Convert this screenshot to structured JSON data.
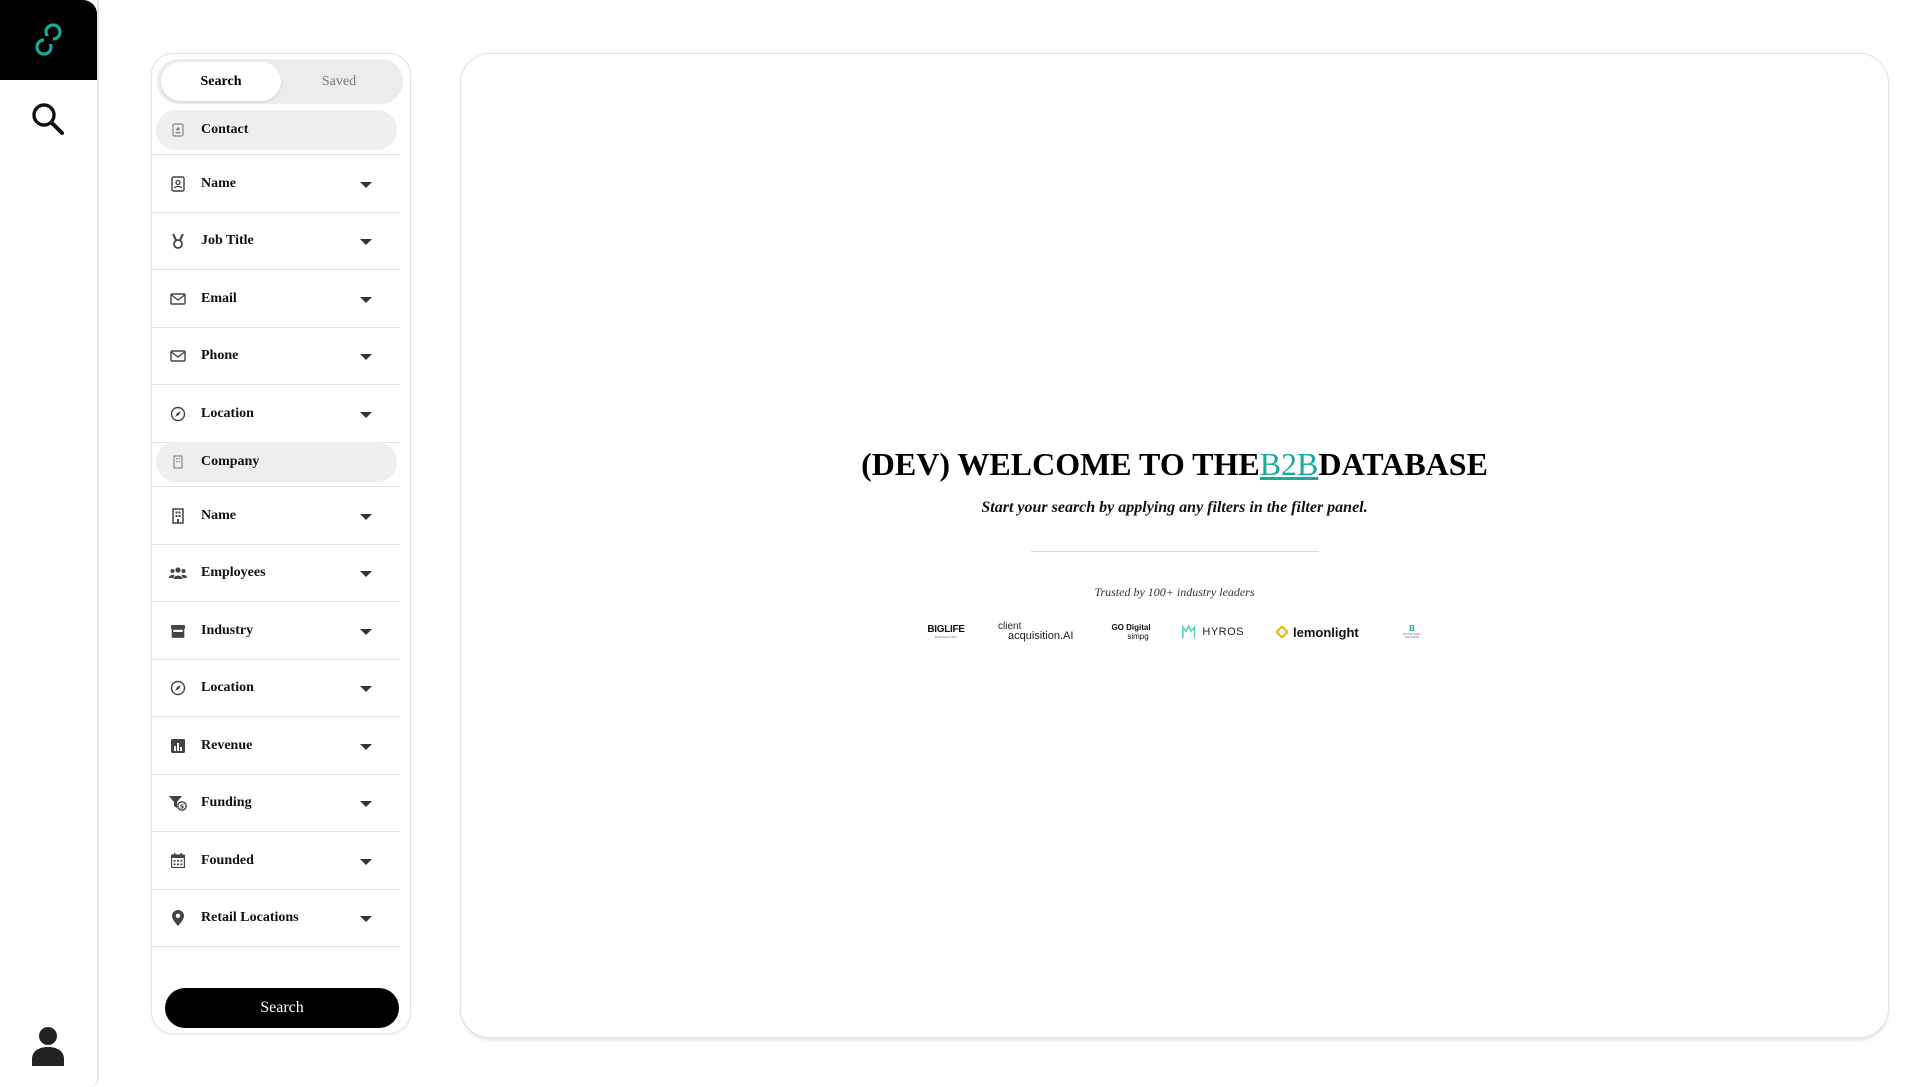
{
  "app": {
    "accent_color": "#1aa99a",
    "primary_color": "#000000"
  },
  "nav": {
    "logo_icon": "link-loop-logo",
    "search_icon": "search-icon",
    "user_icon": "user-icon"
  },
  "filters": {
    "tabs": [
      {
        "label": "Search",
        "active": true
      },
      {
        "label": "Saved",
        "active": false
      }
    ],
    "contact_section": {
      "label": "Contact",
      "items": [
        {
          "label": "Name",
          "icon": "contact-card-icon"
        },
        {
          "label": "Job Title",
          "icon": "medal-icon"
        },
        {
          "label": "Email",
          "icon": "envelope-icon"
        },
        {
          "label": "Phone",
          "icon": "envelope-icon"
        },
        {
          "label": "Location",
          "icon": "compass-icon"
        }
      ]
    },
    "company_section": {
      "label": "Company",
      "items": [
        {
          "label": "Name",
          "icon": "building-icon"
        },
        {
          "label": "Employees",
          "icon": "people-icon"
        },
        {
          "label": "Industry",
          "icon": "store-icon"
        },
        {
          "label": "Location",
          "icon": "compass-icon"
        },
        {
          "label": "Revenue",
          "icon": "bar-chart-icon"
        },
        {
          "label": "Funding",
          "icon": "funnel-dollar-icon"
        },
        {
          "label": "Founded",
          "icon": "calendar-icon"
        },
        {
          "label": "Retail Locations",
          "icon": "map-pin-icon"
        }
      ]
    },
    "search_button": "Search"
  },
  "main": {
    "welcome_prefix": "(DEV) WELCOME TO THE",
    "welcome_accent": "B2B",
    "welcome_suffix": "DATABASE",
    "subtitle": "Start your search by applying any filters in the filter panel.",
    "trusted_text": "Trusted by 100+ industry leaders",
    "logos": [
      {
        "main": "BIGLIFE",
        "sub": "MARKETING"
      },
      {
        "main": "client",
        "sub": "acquisition.AI"
      },
      {
        "main": "GO Digital",
        "sub": "simpg"
      },
      {
        "main": "HYROS"
      },
      {
        "main": "lemonlight"
      },
      {
        "main": "B",
        "sub": "BOYNE LEGAL SOLUTIONS"
      }
    ]
  }
}
